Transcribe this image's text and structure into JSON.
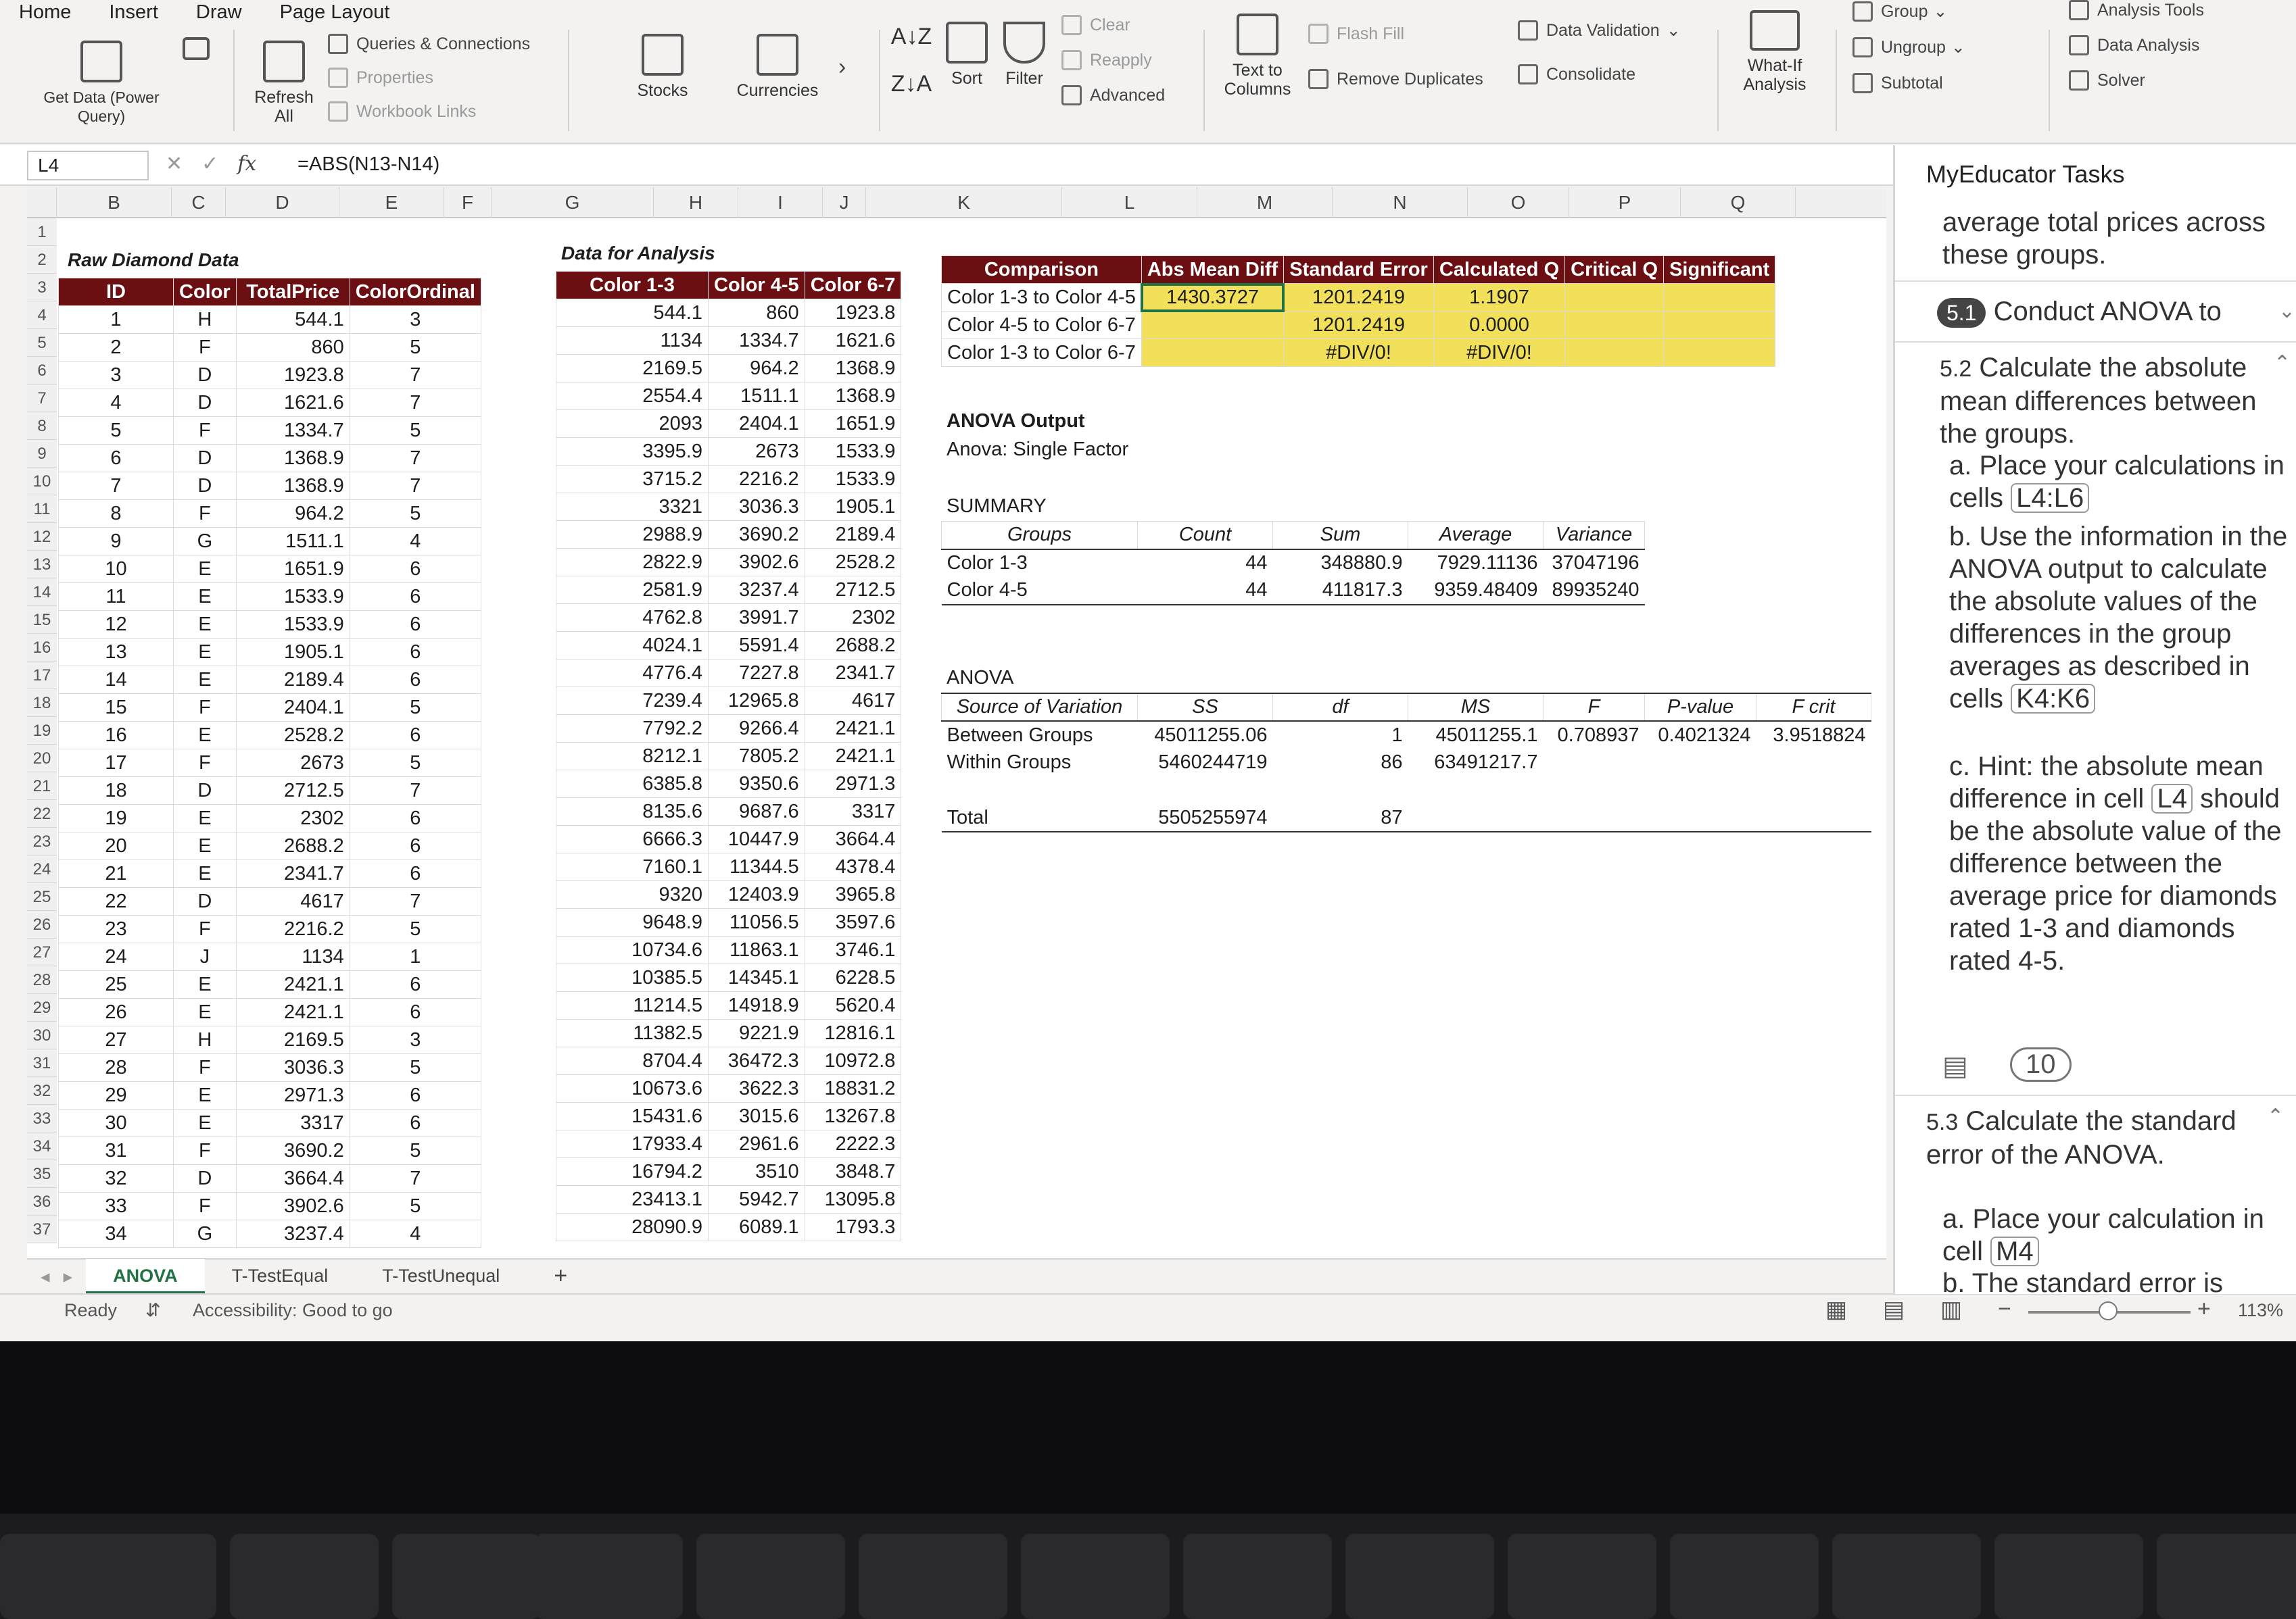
{
  "ribbon": {
    "menu": [
      "Home",
      "Insert",
      "Draw",
      "Page Layout"
    ],
    "get_data": "Get Data (Power Query)",
    "refresh_all": "Refresh All",
    "queries_connections": "Queries & Connections",
    "properties": "Properties",
    "workbook_links": "Workbook Links",
    "stocks": "Stocks",
    "currencies": "Currencies",
    "sort": "Sort",
    "filter": "Filter",
    "clear": "Clear",
    "reapply": "Reapply",
    "advanced": "Advanced",
    "text_to_columns": "Text to Columns",
    "flash_fill": "Flash Fill",
    "remove_duplicates": "Remove Duplicates",
    "data_validation": "Data Validation",
    "consolidate": "Consolidate",
    "what_if": "What-If Analysis",
    "group": "Group",
    "ungroup": "Ungroup",
    "subtotal": "Subtotal",
    "analysis_tools": "Analysis Tools",
    "data_analysis": "Data Analysis",
    "solver": "Solver"
  },
  "formula_bar": {
    "name_box": "L4",
    "formula": "=ABS(N13-N14)"
  },
  "columns": [
    "B",
    "C",
    "D",
    "E",
    "F",
    "G",
    "H",
    "I",
    "J",
    "K",
    "L",
    "M",
    "N",
    "O",
    "P",
    "Q"
  ],
  "rows": [
    "1",
    "2",
    "3",
    "4",
    "5",
    "6",
    "7",
    "8",
    "9",
    "10",
    "11",
    "12",
    "13",
    "14",
    "15",
    "16",
    "17",
    "18",
    "19",
    "20",
    "21",
    "22",
    "23",
    "24",
    "25",
    "26",
    "27",
    "28",
    "29",
    "30",
    "31",
    "32",
    "33",
    "34",
    "35",
    "36",
    "37"
  ],
  "raw": {
    "title": "Raw Diamond Data",
    "headers": [
      "ID",
      "Color",
      "TotalPrice",
      "ColorOrdinal"
    ],
    "rows": [
      [
        "1",
        "H",
        "544.1",
        "3"
      ],
      [
        "2",
        "F",
        "860",
        "5"
      ],
      [
        "3",
        "D",
        "1923.8",
        "7"
      ],
      [
        "4",
        "D",
        "1621.6",
        "7"
      ],
      [
        "5",
        "F",
        "1334.7",
        "5"
      ],
      [
        "6",
        "D",
        "1368.9",
        "7"
      ],
      [
        "7",
        "D",
        "1368.9",
        "7"
      ],
      [
        "8",
        "F",
        "964.2",
        "5"
      ],
      [
        "9",
        "G",
        "1511.1",
        "4"
      ],
      [
        "10",
        "E",
        "1651.9",
        "6"
      ],
      [
        "11",
        "E",
        "1533.9",
        "6"
      ],
      [
        "12",
        "E",
        "1533.9",
        "6"
      ],
      [
        "13",
        "E",
        "1905.1",
        "6"
      ],
      [
        "14",
        "E",
        "2189.4",
        "6"
      ],
      [
        "15",
        "F",
        "2404.1",
        "5"
      ],
      [
        "16",
        "E",
        "2528.2",
        "6"
      ],
      [
        "17",
        "F",
        "2673",
        "5"
      ],
      [
        "18",
        "D",
        "2712.5",
        "7"
      ],
      [
        "19",
        "E",
        "2302",
        "6"
      ],
      [
        "20",
        "E",
        "2688.2",
        "6"
      ],
      [
        "21",
        "E",
        "2341.7",
        "6"
      ],
      [
        "22",
        "D",
        "4617",
        "7"
      ],
      [
        "23",
        "F",
        "2216.2",
        "5"
      ],
      [
        "24",
        "J",
        "1134",
        "1"
      ],
      [
        "25",
        "E",
        "2421.1",
        "6"
      ],
      [
        "26",
        "E",
        "2421.1",
        "6"
      ],
      [
        "27",
        "H",
        "2169.5",
        "3"
      ],
      [
        "28",
        "F",
        "3036.3",
        "5"
      ],
      [
        "29",
        "E",
        "2971.3",
        "6"
      ],
      [
        "30",
        "E",
        "3317",
        "6"
      ],
      [
        "31",
        "F",
        "3690.2",
        "5"
      ],
      [
        "32",
        "D",
        "3664.4",
        "7"
      ],
      [
        "33",
        "F",
        "3902.6",
        "5"
      ],
      [
        "34",
        "G",
        "3237.4",
        "4"
      ]
    ]
  },
  "analysis": {
    "title": "Data for Analysis",
    "headers": [
      "Color 1-3",
      "Color 4-5",
      "Color 6-7"
    ],
    "rows": [
      [
        "544.1",
        "860",
        "1923.8"
      ],
      [
        "1134",
        "1334.7",
        "1621.6"
      ],
      [
        "2169.5",
        "964.2",
        "1368.9"
      ],
      [
        "2554.4",
        "1511.1",
        "1368.9"
      ],
      [
        "2093",
        "2404.1",
        "1651.9"
      ],
      [
        "3395.9",
        "2673",
        "1533.9"
      ],
      [
        "3715.2",
        "2216.2",
        "1533.9"
      ],
      [
        "3321",
        "3036.3",
        "1905.1"
      ],
      [
        "2988.9",
        "3690.2",
        "2189.4"
      ],
      [
        "2822.9",
        "3902.6",
        "2528.2"
      ],
      [
        "2581.9",
        "3237.4",
        "2712.5"
      ],
      [
        "4762.8",
        "3991.7",
        "2302"
      ],
      [
        "4024.1",
        "5591.4",
        "2688.2"
      ],
      [
        "4776.4",
        "7227.8",
        "2341.7"
      ],
      [
        "7239.4",
        "12965.8",
        "4617"
      ],
      [
        "7792.2",
        "9266.4",
        "2421.1"
      ],
      [
        "8212.1",
        "7805.2",
        "2421.1"
      ],
      [
        "6385.8",
        "9350.6",
        "2971.3"
      ],
      [
        "8135.6",
        "9687.6",
        "3317"
      ],
      [
        "6666.3",
        "10447.9",
        "3664.4"
      ],
      [
        "7160.1",
        "11344.5",
        "4378.4"
      ],
      [
        "9320",
        "12403.9",
        "3965.8"
      ],
      [
        "9648.9",
        "11056.5",
        "3597.6"
      ],
      [
        "10734.6",
        "11863.1",
        "3746.1"
      ],
      [
        "10385.5",
        "14345.1",
        "6228.5"
      ],
      [
        "11214.5",
        "14918.9",
        "5620.4"
      ],
      [
        "11382.5",
        "9221.9",
        "12816.1"
      ],
      [
        "8704.4",
        "36472.3",
        "10972.8"
      ],
      [
        "10673.6",
        "3622.3",
        "18831.2"
      ],
      [
        "15431.6",
        "3015.6",
        "13267.8"
      ],
      [
        "17933.4",
        "2961.6",
        "2222.3"
      ],
      [
        "16794.2",
        "3510",
        "3848.7"
      ],
      [
        "23413.1",
        "5942.7",
        "13095.8"
      ],
      [
        "28090.9",
        "6089.1",
        "1793.3"
      ]
    ]
  },
  "comparison": {
    "headers": [
      "Comparison",
      "Abs Mean Diff",
      "Standard Error",
      "Calculated Q",
      "Critical Q",
      "Significant"
    ],
    "rows": [
      [
        "Color 1-3 to Color 4-5",
        "1430.3727",
        "1201.2419",
        "1.1907",
        "",
        ""
      ],
      [
        "Color 4-5 to Color 6-7",
        "",
        "1201.2419",
        "0.0000",
        "",
        ""
      ],
      [
        "Color 1-3 to Color 6-7",
        "",
        "#DIV/0!",
        "#DIV/0!",
        "",
        ""
      ]
    ]
  },
  "anova": {
    "output_title": "ANOVA Output",
    "subtitle": "Anova: Single Factor",
    "summary_label": "SUMMARY",
    "summary_headers": [
      "Groups",
      "Count",
      "Sum",
      "Average",
      "Variance"
    ],
    "summary_rows": [
      [
        "Color 1-3",
        "44",
        "348880.9",
        "7929.11136",
        "37047196"
      ],
      [
        "Color 4-5",
        "44",
        "411817.3",
        "9359.48409",
        "89935240"
      ]
    ],
    "anova_label": "ANOVA",
    "table_headers": [
      "Source of Variation",
      "SS",
      "df",
      "MS",
      "F",
      "P-value",
      "F crit"
    ],
    "table_rows": [
      [
        "Between Groups",
        "45011255.06",
        "1",
        "45011255.1",
        "0.708937",
        "0.4021324",
        "3.9518824"
      ],
      [
        "Within Groups",
        "5460244719",
        "86",
        "63491217.7",
        "",
        "",
        ""
      ]
    ],
    "total_row": [
      "Total",
      "5505255974",
      "87",
      "",
      "",
      "",
      ""
    ]
  },
  "sheet_tabs": [
    "ANOVA",
    "T-TestEqual",
    "T-TestUnequal"
  ],
  "add_sheet": "+",
  "status": {
    "ready": "Ready",
    "accessibility": "Accessibility: Good to go",
    "zoom": "113%"
  },
  "task_pane": {
    "title": "MyEducator Tasks",
    "intro": "average total prices across these groups.",
    "task_5_1_badge": "5.1",
    "task_5_1": "Conduct ANOVA to",
    "task_5_2_num": "5.2",
    "task_5_2": "Calculate the absolute mean differences between the groups.",
    "a_label": "a.",
    "a_text": "Place your calculations in cells",
    "a_ref": "L4:L6",
    "b_label": "b.",
    "b_text": "Use the information in the ANOVA output to calculate the absolute values of the differences in the group averages as described in cells",
    "b_ref": "K4:K6",
    "c_label": "c.",
    "c_text1": "Hint: the absolute mean difference in cell",
    "c_ref": "L4",
    "c_text2": "should be the absolute value of the difference between the average price for diamonds rated 1-3 and diamonds rated 4-5.",
    "points": "10",
    "task_5_3_num": "5.3",
    "task_5_3": "Calculate the standard error of the ANOVA.",
    "d_label": "a.",
    "d_text": "Place your calculation in cell",
    "d_ref": "M4",
    "e_label": "b.",
    "e_text": "The standard error is equal to the squared"
  },
  "colors": {
    "header_maroon": "#6b0f13",
    "highlight_yellow": "#f2e05a",
    "excel_green": "#217346"
  }
}
